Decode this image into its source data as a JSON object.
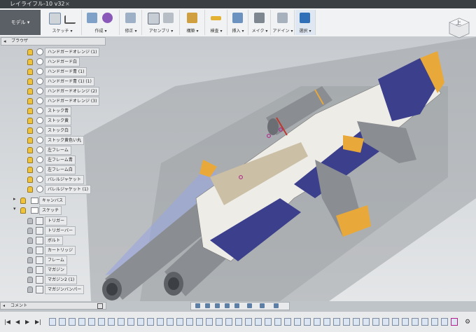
{
  "window": {
    "title": "レイライフル-10 v32",
    "close": "×"
  },
  "toolbar": {
    "workspace": "モデル ▾",
    "groups": [
      {
        "label": "スケッチ ▾"
      },
      {
        "label": "作成 ▾"
      },
      {
        "label": "修正 ▾"
      },
      {
        "label": "アセンブリ ▾"
      },
      {
        "label": "構築 ▾"
      },
      {
        "label": "検査 ▾"
      },
      {
        "label": "挿入 ▾"
      },
      {
        "label": "メイク ▾"
      },
      {
        "label": "アドイン ▾"
      },
      {
        "label": "選択 ▾"
      }
    ]
  },
  "viewcube": {
    "face": "上"
  },
  "browser": {
    "title": "ブラウザ",
    "items": [
      {
        "label": "ハンドガードオレンジ (1)"
      },
      {
        "label": "ハンドガード白"
      },
      {
        "label": "ハンドガード青 (1)"
      },
      {
        "label": "ハンドガード青 (1) (1)"
      },
      {
        "label": "ハンドガードオレンジ (2)"
      },
      {
        "label": "ハンドガードオレンジ (3)"
      },
      {
        "label": "ストック青"
      },
      {
        "label": "ストック黄"
      },
      {
        "label": "ストック白"
      },
      {
        "label": "ストック黄色い丸"
      },
      {
        "label": "左フレーム"
      },
      {
        "label": "左フレーム青"
      },
      {
        "label": "左フレーム白"
      },
      {
        "label": "バレルジャケット"
      },
      {
        "label": "バレルジャケット (1)"
      }
    ],
    "folders": [
      {
        "label": "キャンバス"
      },
      {
        "label": "スケッチ"
      }
    ],
    "sketches": [
      {
        "label": "トリガー"
      },
      {
        "label": "トリガーバー"
      },
      {
        "label": "ボルト"
      },
      {
        "label": "カートリッジ"
      },
      {
        "label": "フレーム"
      },
      {
        "label": "マガジン"
      },
      {
        "label": "マガジン2 (1)"
      },
      {
        "label": "マガジンバンパー"
      }
    ]
  },
  "comments": {
    "label": "コメント"
  },
  "colors": {
    "navy": "#3b3f8c",
    "orange": "#e9a93a",
    "white": "#eeece6",
    "grey": "#8e9196",
    "accent": "#2e6fb7"
  }
}
